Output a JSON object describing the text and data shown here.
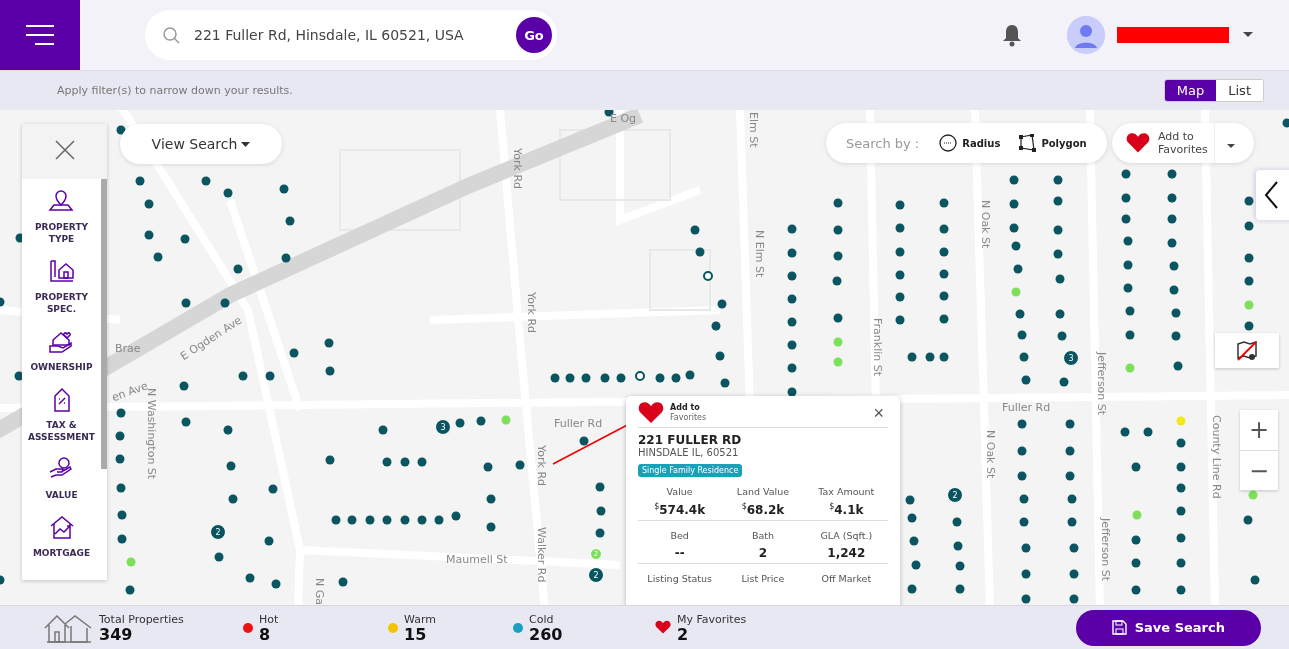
{
  "header": {
    "search": {
      "value": "221 Fuller Rd, Hinsdale, IL 60521, USA",
      "button": "Go"
    }
  },
  "filter_bar": {
    "hint": "Apply filter(s) to narrow down your results.",
    "views": [
      {
        "label": "Map",
        "selected": true
      },
      {
        "label": "List",
        "selected": false
      }
    ]
  },
  "sidebar": {
    "items": [
      {
        "label": "PROPERTY TYPE"
      },
      {
        "label": "PROPERTY SPEC."
      },
      {
        "label": "OWNERSHIP"
      },
      {
        "label": "TAX & ASSESSMENT"
      },
      {
        "label": "VALUE"
      },
      {
        "label": "MORTGAGE"
      }
    ]
  },
  "map": {
    "view_search": "View Search",
    "search_by": {
      "label": "Search by :",
      "options": [
        "Radius",
        "Polygon"
      ]
    },
    "favorites_button": {
      "line1": "Add to",
      "line2": "Favorites"
    },
    "streets": [
      "E Ogden Ave",
      "en Ave",
      "Brae",
      "N Washington St",
      "York Rd",
      "York Rd",
      "York Rd",
      "Walker Rd",
      "Maumell St",
      "Fuller Rd",
      "Fuller Rd",
      "N Elm St",
      "Elm St",
      "Franklin St",
      "N Oak St",
      "N Oak St",
      "Jefferson St",
      "Jefferson St",
      "County Line Rd",
      "E Og",
      "N Ga"
    ],
    "clusters": [
      {
        "label": "3"
      },
      {
        "label": "3"
      },
      {
        "label": "2"
      },
      {
        "label": "2"
      },
      {
        "label": "2"
      },
      {
        "label": "2"
      }
    ],
    "zoom": [
      "+",
      "−"
    ]
  },
  "popup": {
    "favorite": {
      "line1": "Add to",
      "line2": "Favorites"
    },
    "close": "×",
    "title": "221 FULLER RD",
    "subtitle": "HINSDALE IL, 60521",
    "tag": "Single Family Residence",
    "rows": [
      [
        {
          "label": "Value",
          "currency": "$",
          "value": "574.4k"
        },
        {
          "label": "Land Value",
          "currency": "$",
          "value": "68.2k"
        },
        {
          "label": "Tax Amount",
          "currency": "$",
          "value": "4.1k"
        }
      ],
      [
        {
          "label": "Bed",
          "value": "--"
        },
        {
          "label": "Bath",
          "value": "2"
        },
        {
          "label": "GLA (Sqft.)",
          "value": "1,242"
        }
      ],
      [
        {
          "label": "Listing Status"
        },
        {
          "label": "List Price"
        },
        {
          "label": "Off Market"
        }
      ]
    ]
  },
  "stats": [
    {
      "kind": "total",
      "label": "Total Properties",
      "value": "349"
    },
    {
      "kind": "dot",
      "label": "Hot",
      "value": "8",
      "color": "#ee1111"
    },
    {
      "kind": "dot",
      "label": "Warm",
      "value": "15",
      "color": "#f5c400"
    },
    {
      "kind": "dot",
      "label": "Cold",
      "value": "260",
      "color": "#1a9fbf"
    },
    {
      "kind": "favorite",
      "label": "My Favorites",
      "value": "2"
    }
  ],
  "save_button": "Save Search"
}
